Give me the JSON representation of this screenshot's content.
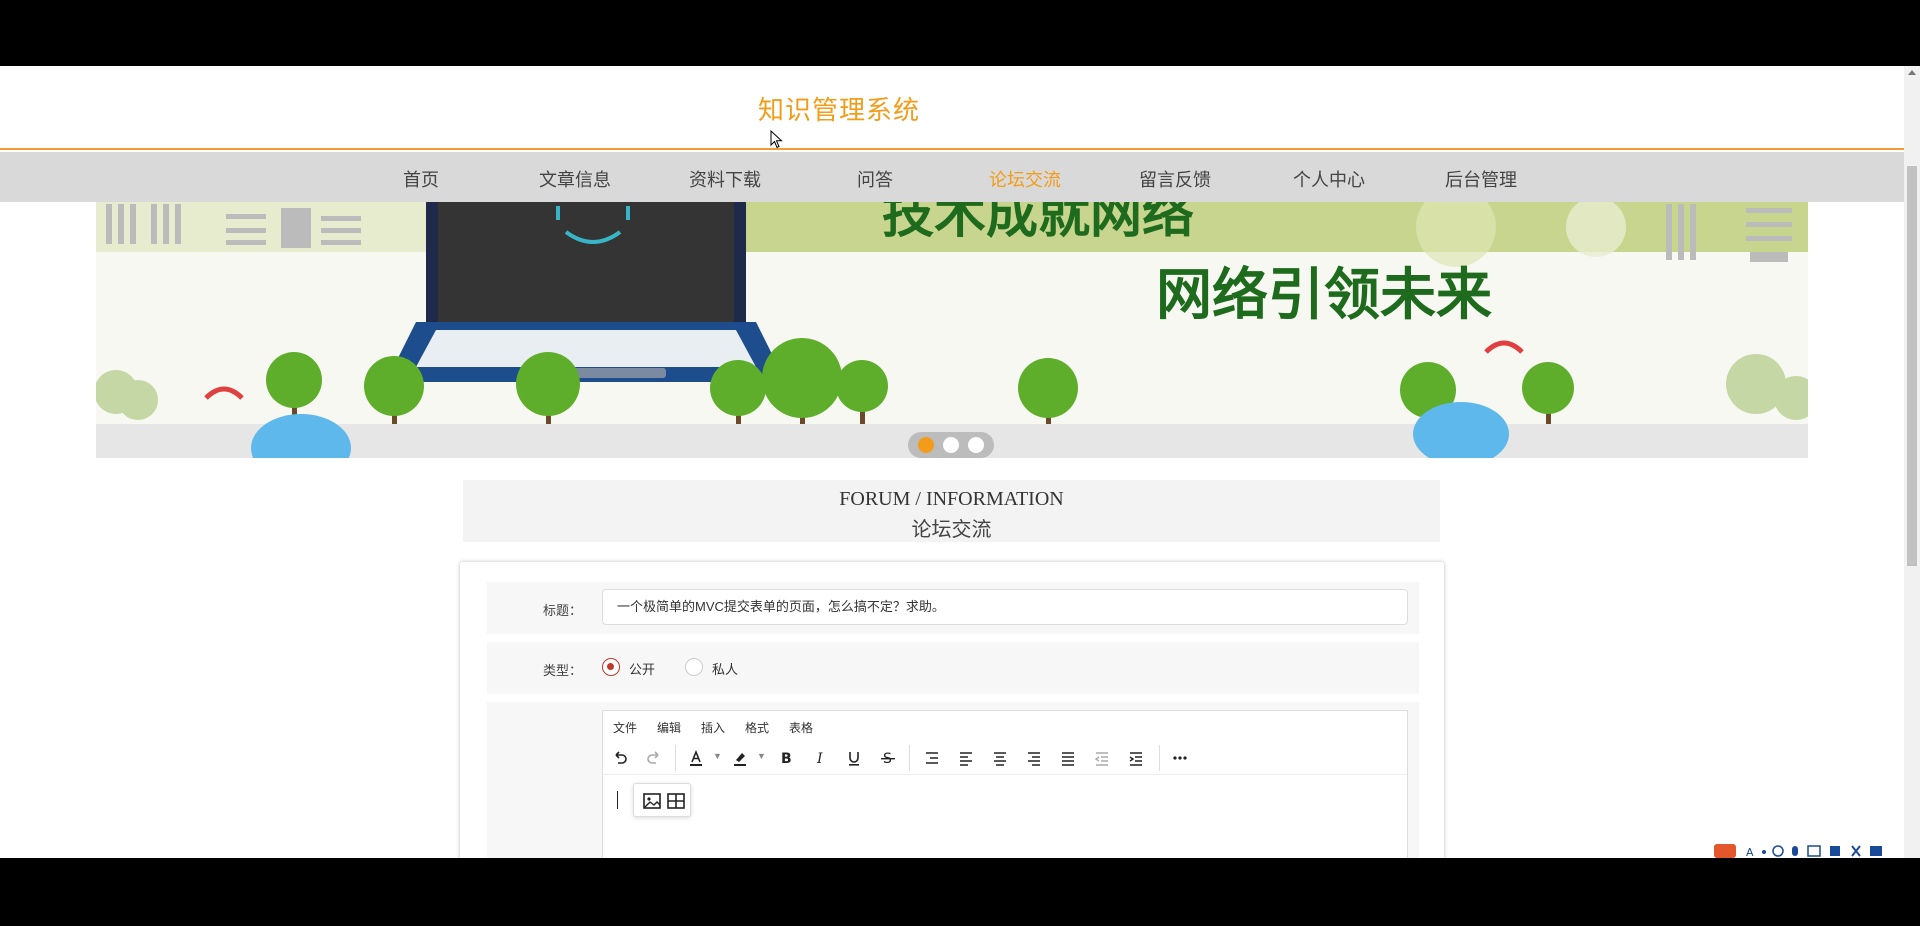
{
  "site": {
    "title": "知识管理系统"
  },
  "nav": {
    "items": [
      {
        "label": "首页",
        "active": false
      },
      {
        "label": "文章信息",
        "active": false
      },
      {
        "label": "资料下载",
        "active": false
      },
      {
        "label": "问答",
        "active": false
      },
      {
        "label": "论坛交流",
        "active": true
      },
      {
        "label": "留言反馈",
        "active": false
      },
      {
        "label": "个人中心",
        "active": false
      },
      {
        "label": "后台管理",
        "active": false
      }
    ]
  },
  "banner": {
    "line1": "技术成就网络",
    "line2": "网络引领未来",
    "slide_count": 3,
    "active_slide": 0
  },
  "section": {
    "title_en": "FORUM / INFORMATION",
    "title_cn": "论坛交流"
  },
  "form": {
    "title_label": "标题：",
    "title_value": "一个极简单的MVC提交表单的页面，怎么搞不定？求助。",
    "type_label": "类型：",
    "type_options": [
      {
        "label": "公开",
        "checked": true
      },
      {
        "label": "私人",
        "checked": false
      }
    ]
  },
  "editor": {
    "menu": [
      "文件",
      "编辑",
      "插入",
      "格式",
      "表格"
    ]
  },
  "colors": {
    "accent": "#f39c1a",
    "nav_bg": "#d9d9d9",
    "radio_checked": "#c0392b"
  }
}
